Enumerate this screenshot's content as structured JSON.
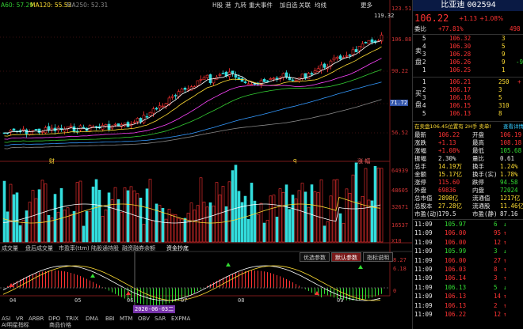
{
  "toolbar": {
    "ma_labels": [
      {
        "text": "A60: 57.29",
        "color": "#33cc33"
      },
      {
        "text": "MA120: 55.53",
        "color": "#ffdd33"
      },
      {
        "text": "MA250: 52.31",
        "color": "#888888"
      }
    ],
    "buttons": [
      "H股",
      "港",
      "九转",
      "重大事件",
      "加自选",
      "关联",
      "均线",
      "更多"
    ]
  },
  "price_axis": [
    "123.51",
    "106.88",
    "90.22",
    "71.72",
    "56.52"
  ],
  "price_tags": {
    "high": "119.32",
    "current": "71.72"
  },
  "volume_axis": [
    "64939",
    "48605",
    "32671",
    "16537",
    "X10"
  ],
  "indicator_axis": [
    "8.27",
    "6.18",
    "0"
  ],
  "markers": {
    "m1": "财",
    "m2": "q",
    "m3": "涨 幅"
  },
  "x_axis": [
    "04",
    "05",
    "06",
    "07",
    "08",
    "09"
  ],
  "date_highlight": "2020-06-03二",
  "bottom_tabs_1": [
    "成交量",
    "盘后成交量",
    "市盈率(ttm)",
    "陆股通持股",
    "融资融券余额",
    "资金抄底"
  ],
  "indicator_buttons": [
    "优选参数",
    "默认参数",
    "指标说明"
  ],
  "bottom_tabs_2": [
    "ASI",
    "VR",
    "ARBR",
    "DPO",
    "TRIX",
    "DMA",
    "BBI",
    "MTM",
    "OBV",
    "SAR",
    "EXPMA"
  ],
  "bottom_tabs_3": [
    "AI明星指标",
    "商品价格"
  ],
  "stock": {
    "name": "比亚迪",
    "code": "002594",
    "price": "106.22",
    "change": "+1.13",
    "change_pct": "+1.08%",
    "wei_bi_label": "委比",
    "wei_bi": "+77.81%",
    "wei_bi_val": "498",
    "sell_label": "卖 盘",
    "buy_label": "买 盘",
    "sell": [
      {
        "lvl": "5",
        "price": "106.32",
        "vol": "3",
        "chg": ""
      },
      {
        "lvl": "4",
        "price": "106.30",
        "vol": "5",
        "chg": ""
      },
      {
        "lvl": "3",
        "price": "106.28",
        "vol": "9",
        "chg": ""
      },
      {
        "lvl": "2",
        "price": "106.26",
        "vol": "9",
        "chg": "-9"
      },
      {
        "lvl": "1",
        "price": "106.25",
        "vol": "1",
        "chg": ""
      }
    ],
    "buy": [
      {
        "lvl": "1",
        "price": "106.21",
        "vol": "250",
        "chg": "+"
      },
      {
        "lvl": "2",
        "price": "106.17",
        "vol": "3",
        "chg": ""
      },
      {
        "lvl": "3",
        "price": "106.16",
        "vol": "5",
        "chg": ""
      },
      {
        "lvl": "4",
        "price": "106.15",
        "vol": "310",
        "chg": ""
      },
      {
        "lvl": "5",
        "price": "106.13",
        "vol": "8",
        "chg": ""
      }
    ],
    "notice": "在卖盘106.45位置有 2H手 卖单!",
    "notice_link": "查看详情",
    "quote_left": [
      {
        "k": "最新",
        "v": "106.22",
        "c": "red"
      },
      {
        "k": "涨跌",
        "v": "+1.13",
        "c": "red"
      },
      {
        "k": "涨幅",
        "v": "+1.08%",
        "c": "red"
      },
      {
        "k": "振幅",
        "v": "2.30%",
        "c": "wht"
      },
      {
        "k": "总手",
        "v": "14.19万",
        "c": "yel"
      },
      {
        "k": "金额",
        "v": "15.17亿",
        "c": "yel"
      },
      {
        "k": "涨停",
        "v": "115.60",
        "c": "red"
      },
      {
        "k": "外盘",
        "v": "69836",
        "c": "red"
      },
      {
        "k": "总市值",
        "v": "2898亿",
        "c": "yel"
      },
      {
        "k": "总股本",
        "v": "27.28亿",
        "c": "yel"
      },
      {
        "k": "市盈(动)",
        "v": "179.5",
        "c": "wht"
      }
    ],
    "quote_right": [
      {
        "k": "开盘",
        "v": "106.19",
        "c": "red"
      },
      {
        "k": "最高",
        "v": "108.18",
        "c": "red"
      },
      {
        "k": "最低",
        "v": "105.68",
        "c": "grn"
      },
      {
        "k": "量比",
        "v": "0.61",
        "c": "wht"
      },
      {
        "k": "换手",
        "v": "1.24%",
        "c": "yel"
      },
      {
        "k": "换手(实)",
        "v": "1.78%",
        "c": "yel"
      },
      {
        "k": "跌停",
        "v": "94.58",
        "c": "grn"
      },
      {
        "k": "内盘",
        "v": "72024",
        "c": "grn"
      },
      {
        "k": "流通值",
        "v": "1217亿",
        "c": "yel"
      },
      {
        "k": "流通股",
        "v": "11.46亿",
        "c": "yel"
      },
      {
        "k": "市盈(静)",
        "v": "87.16",
        "c": "wht"
      }
    ],
    "ticks": [
      {
        "t": "11:09",
        "p": "105.97",
        "v": "6",
        "c": "grn",
        "a": "↓"
      },
      {
        "t": "11:09",
        "p": "106.00",
        "v": "95",
        "c": "red",
        "a": "↑"
      },
      {
        "t": "11:09",
        "p": "106.00",
        "v": "12",
        "c": "red",
        "a": "↑"
      },
      {
        "t": "11:09",
        "p": "105.99",
        "v": "3",
        "c": "grn",
        "a": "↓"
      },
      {
        "t": "11:09",
        "p": "106.00",
        "v": "27",
        "c": "red",
        "a": "↑"
      },
      {
        "t": "11:09",
        "p": "106.03",
        "v": "8",
        "c": "red",
        "a": "↑"
      },
      {
        "t": "11:09",
        "p": "106.14",
        "v": "3",
        "c": "red",
        "a": "↑"
      },
      {
        "t": "11:09",
        "p": "106.13",
        "v": "5",
        "c": "grn",
        "a": "↓"
      },
      {
        "t": "11:09",
        "p": "106.13",
        "v": "14",
        "c": "red",
        "a": "↑"
      },
      {
        "t": "11:09",
        "p": "106.13",
        "v": "2",
        "c": "red",
        "a": "↑"
      },
      {
        "t": "11:09",
        "p": "106.22",
        "v": "12",
        "c": "red",
        "a": "↑"
      }
    ]
  }
}
